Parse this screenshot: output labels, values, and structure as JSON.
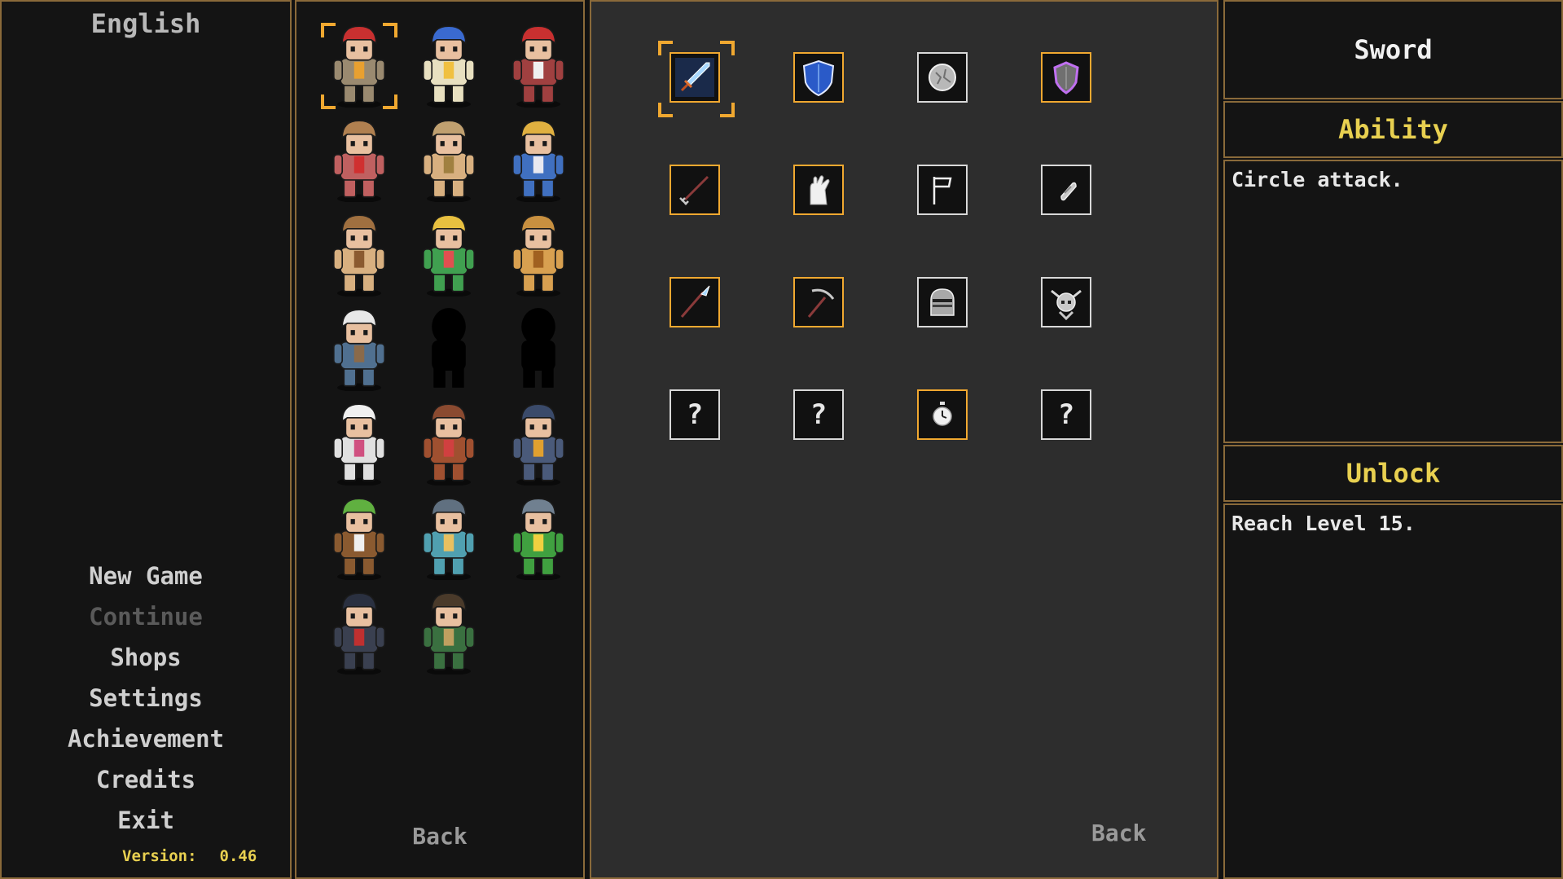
{
  "language": "English",
  "menu": {
    "new_game": "New Game",
    "continue": "Continue",
    "shops": "Shops",
    "settings": "Settings",
    "achievement": "Achievement",
    "credits": "Credits",
    "exit": "Exit"
  },
  "version": {
    "label": "Version:",
    "value": "0.46"
  },
  "roster": {
    "back_label": "Back",
    "characters": [
      {
        "name": "red-hair-warrior",
        "hair": "#c83030",
        "body": "#9a8a70",
        "accent": "#e8a030",
        "selected": true
      },
      {
        "name": "blue-hood-mage",
        "hair": "#3a6ad0",
        "body": "#e8e0c0",
        "accent": "#f0c040"
      },
      {
        "name": "red-hat-bard",
        "hair": "#c83030",
        "body": "#a04040",
        "accent": "#f0f0f0"
      },
      {
        "name": "masked-bandit",
        "hair": "#b08050",
        "body": "#c06060",
        "accent": "#d03030"
      },
      {
        "name": "horned-barbarian",
        "hair": "#c0a070",
        "body": "#d8b080",
        "accent": "#a08040"
      },
      {
        "name": "blue-armored-knight",
        "hair": "#e0b040",
        "body": "#4070c0",
        "accent": "#e8e8f0"
      },
      {
        "name": "spiky-fighter",
        "hair": "#a07040",
        "body": "#d8b080",
        "accent": "#8a5a30"
      },
      {
        "name": "blonde-ranger",
        "hair": "#e8c040",
        "body": "#40a050",
        "accent": "#e05050"
      },
      {
        "name": "golden-beast",
        "hair": "#c89040",
        "body": "#d8a050",
        "accent": "#a06020"
      },
      {
        "name": "white-hair-monk",
        "hair": "#e8e8e8",
        "body": "#507090",
        "accent": "#8a6a4a"
      },
      {
        "name": "locked-silhouette",
        "silhouette": true
      },
      {
        "name": "locked-silhouette",
        "silhouette": true
      },
      {
        "name": "white-hat-doctor",
        "hair": "#f0f0f0",
        "body": "#e0e0e0",
        "accent": "#d05080"
      },
      {
        "name": "brown-golem",
        "hair": "#8a4a30",
        "body": "#a05030",
        "accent": "#d04040"
      },
      {
        "name": "dark-armor-knight",
        "hair": "#3a4a6a",
        "body": "#4a5a7a",
        "accent": "#e0a030"
      },
      {
        "name": "green-hat-archer",
        "hair": "#60b040",
        "body": "#8a5a30",
        "accent": "#f0f0f0"
      },
      {
        "name": "turban-sage",
        "hair": "#607080",
        "body": "#50a0b0",
        "accent": "#e8c060"
      },
      {
        "name": "green-spiky-hero",
        "hair": "#708090",
        "body": "#40a040",
        "accent": "#f0d040"
      },
      {
        "name": "dark-ninja",
        "hair": "#2a3040",
        "body": "#3a4050",
        "accent": "#c03030"
      },
      {
        "name": "braided-warrior",
        "hair": "#4a3a2a",
        "body": "#3a7040",
        "accent": "#c0a060"
      }
    ]
  },
  "items": {
    "back_label": "Back",
    "grid": [
      {
        "icon": "sword-icon",
        "border": "gold",
        "selected": true
      },
      {
        "icon": "blue-shield-icon",
        "border": "gold"
      },
      {
        "icon": "stone-icon",
        "border": "white"
      },
      {
        "icon": "purple-shield-icon",
        "border": "gold"
      },
      {
        "icon": "trident-icon",
        "border": "gold"
      },
      {
        "icon": "gauntlet-icon",
        "border": "gold"
      },
      {
        "icon": "flag-icon",
        "border": "white"
      },
      {
        "icon": "gem-icon",
        "border": "white"
      },
      {
        "icon": "spear-icon",
        "border": "gold"
      },
      {
        "icon": "pickaxe-icon",
        "border": "gold"
      },
      {
        "icon": "helmet-icon",
        "border": "white"
      },
      {
        "icon": "horned-skull-icon",
        "border": "white"
      },
      {
        "icon": "question-icon",
        "border": "white",
        "text": "?"
      },
      {
        "icon": "question-icon",
        "border": "white",
        "text": "?"
      },
      {
        "icon": "stopwatch-icon",
        "border": "gold"
      },
      {
        "icon": "question-icon",
        "border": "white",
        "text": "?"
      }
    ]
  },
  "info": {
    "item_name": "Sword",
    "ability_heading": "Ability",
    "ability_text": "Circle attack.",
    "unlock_heading": "Unlock",
    "unlock_text": "Reach Level 15."
  }
}
